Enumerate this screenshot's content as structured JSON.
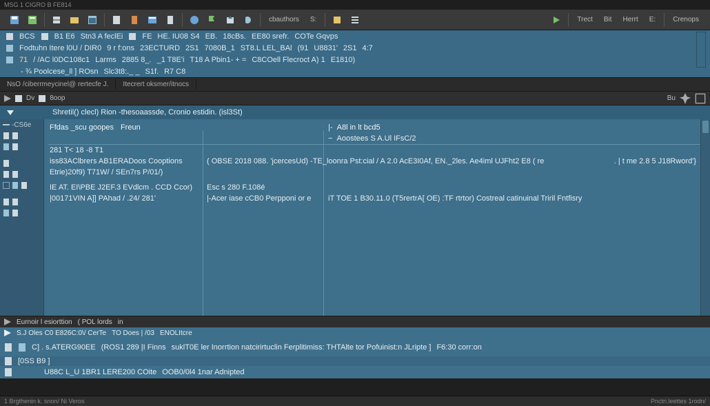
{
  "window": {
    "title": "MSG 1 CIGRO B FE814"
  },
  "toolbar": {
    "buttons": [
      "disk-icon",
      "project-icon",
      "stack-icon",
      "grid-icon",
      "window-icon",
      "sheet-icon",
      "bookmark-icon",
      "terminal-icon",
      "page-icon",
      "globe-icon",
      "flag-icon",
      "export-icon",
      "sync-icon"
    ],
    "label_buttons": [
      "cbauthors",
      "S:"
    ],
    "right_buttons": [
      "Trect",
      "Bit",
      "Herrt",
      "E:",
      "Crenops"
    ]
  },
  "ribbon": {
    "row1": [
      "BCS",
      "B1 E6",
      "Stn3 A feclEi",
      "FE",
      "HE. IU08 S4",
      "EB.",
      "18cBs.",
      "EE80 srefr.",
      "COTe Gqvps"
    ],
    "row2": [
      "Fodtuhn Itere l0U / DIR0",
      "9 r f:ons",
      "23ECTURD",
      "2S1",
      "7080B_1",
      "ST8.L LEL_BAl",
      "(91",
      "U8831'",
      "2S1",
      "4:7"
    ],
    "row3": [
      "71",
      "/ /AC l0DC108c1",
      "Larms",
      "2885 8_.",
      "_1 T8E'i",
      "T18 A Pbin1- + =",
      "C8COell Flecroct A)  1",
      "E1810)"
    ],
    "row4": [
      "- ¾  Poolcese_ll ] ROsn",
      "Slc3t8:._  _",
      "S1f.",
      "R7 C8"
    ]
  },
  "tabs": [
    "NsO /ciberrmeycinel@ rertecfe J.",
    "Itecrert  oksmer/itnocs"
  ],
  "panel2": {
    "left_tabs": [
      "Dv",
      "8oop"
    ],
    "right_label": "Bu"
  },
  "editor": {
    "title": "Shretil() clecl) Rion  -thesoaassde,  Cronio estidin.  (isl3St)",
    "root_label": "-CS6e",
    "columns": [
      "Ffdas  _scu  goopes",
      "Freun",
      "A8l in lt  bcd5",
      "Aoostees S A.Ul  IFsC/2"
    ],
    "rows": [
      {
        "c1": "281 T< 18 -8 T1",
        "c2": "",
        "c3": ""
      },
      {
        "c1": "iss83AClbrers  AB1ERADoos  Cooptions",
        "c2": "( OBSE 2018 088.  'jcercesUd)  -TE_loonra  Pst:cial /  A 2.0  AcE3I0Af,  EN._2les. Ae4iml  UJFht2 E8 ( re",
        "c3": ".  | t me  2.8 5 J18Rword'}"
      },
      {
        "c1": "Etrie)20f9)  T71W/ / SEn7rs  P/01/)",
        "c2": "",
        "c3": ""
      },
      {
        "c1": "IE AT. EI\\PBE  J2EF.3 EVdlcm .  CCD Ccor)",
        "c2": "Esc s 280  F.108é",
        "c3": ""
      },
      {
        "c1": "|00171VIN A]] PAhad  / .24/ 281'",
        "c2": "|-Acer iase cCB0 Perpponi or e",
        "c3": "iT TOE  1 B30.11.0 (T5rertrA[ OE)   :TF  rtrtor)   Costreal catinuinal Triril Fntfisry"
      }
    ]
  },
  "console": {
    "header": [
      "Eurnoir l  esiorttion",
      "( POL lords",
      "in"
    ],
    "sub": [
      "S.J Oles  C0  E826C:0\\/  CerTe",
      "TO Does | /03",
      "ENOLItcre"
    ],
    "rows": [
      {
        "a": "C] . s.ATERG90EE",
        "b": "(ROS1 289 |I Finns",
        "c": "suklT0E ler Inorrtion  natcirirtuclin Ferplitimiss:  THTAlte   tor   Pofuinist:n JLripte  ]",
        "d": "F6:30 corr:on"
      },
      {
        "a": "[0SS B9 ]",
        "b": "",
        "c": "",
        "d": ""
      },
      {
        "a": "",
        "b": "U88C L_U  1BR1 LERE200 COite",
        "c": "OOB0/0l4  1nar  Adnipted",
        "d": ""
      }
    ]
  },
  "status": {
    "left": "1 Brgthenin k. snon/ Ni Veros",
    "right": "Pnctri.leettes 1rodn/"
  }
}
